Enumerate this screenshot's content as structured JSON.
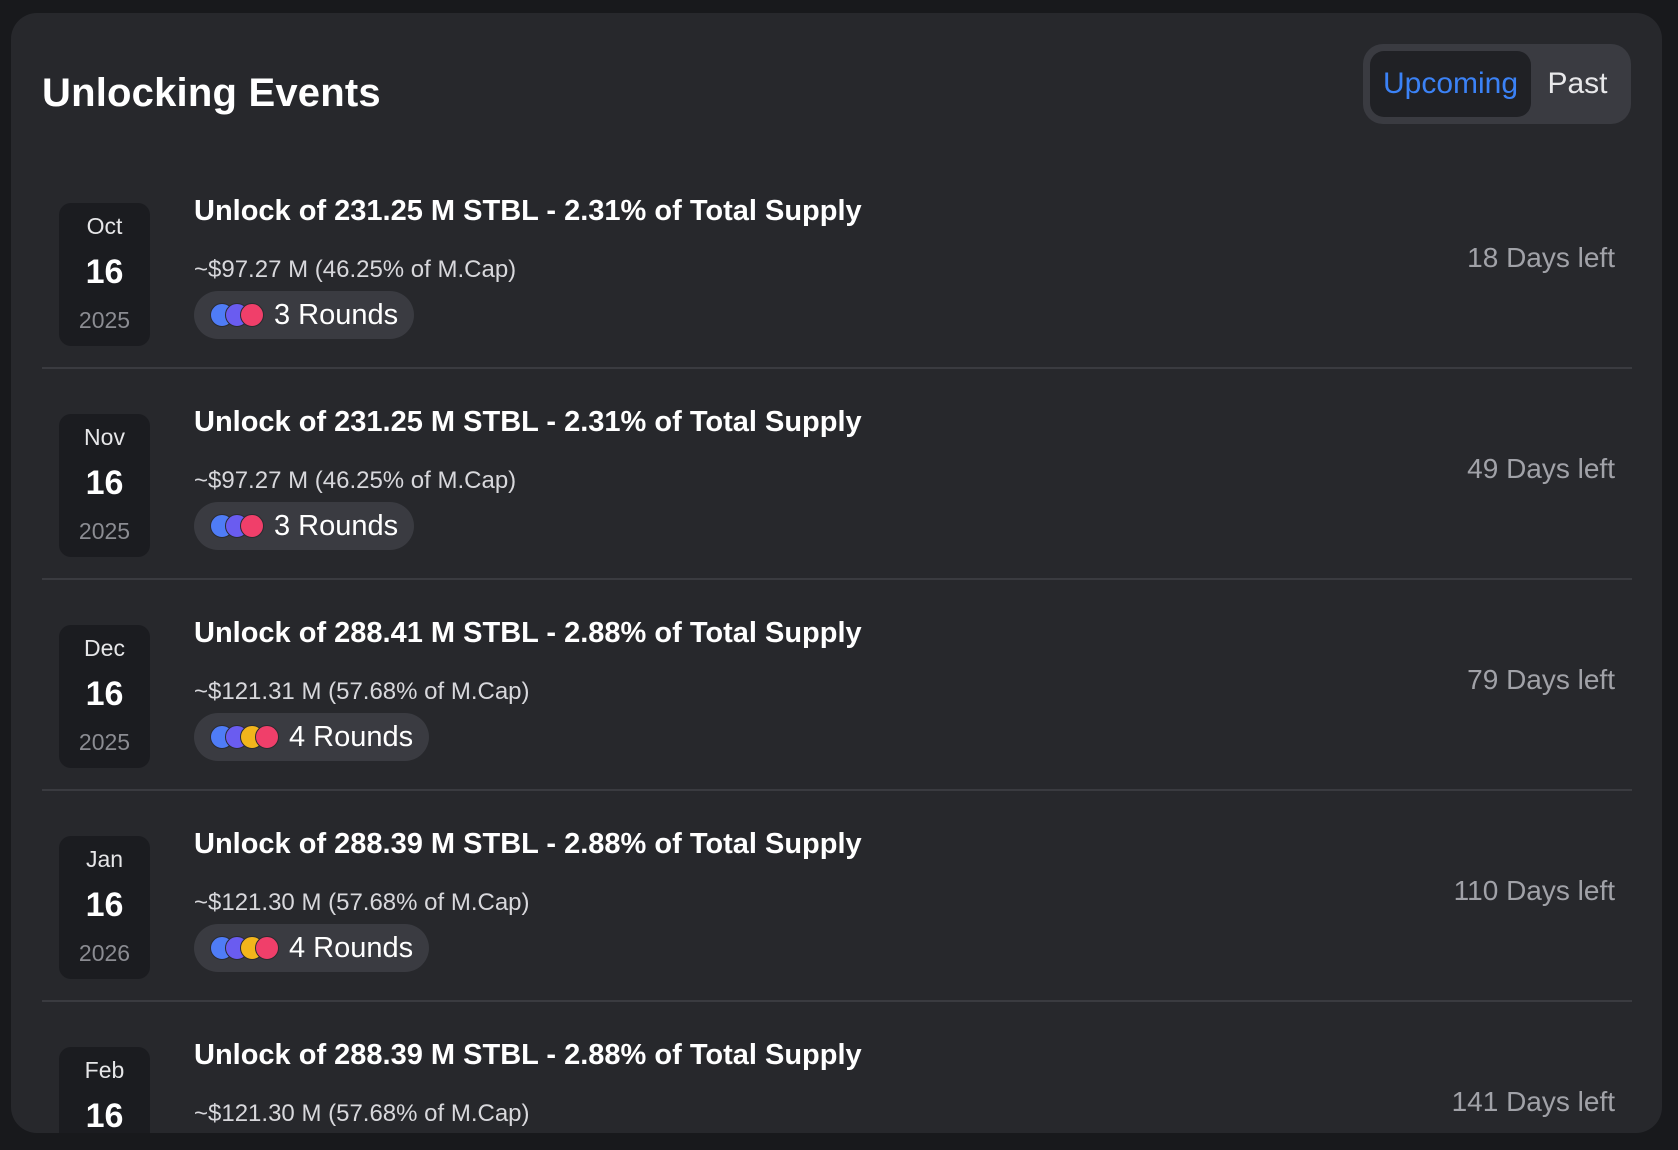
{
  "title": "Unlocking Events",
  "toggle": {
    "active": "Upcoming",
    "inactive": "Past"
  },
  "colors": {
    "accent": "#3b82f6",
    "dot_blue": "#4f7cf6",
    "dot_purple": "#6a5cf0",
    "dot_yellow": "#f2b51c",
    "dot_red": "#f03f6a"
  },
  "events": [
    {
      "month": "Oct",
      "day": "16",
      "year": "2025",
      "headline": "Unlock of 231.25 M STBL - 2.31% of Total Supply",
      "sub": "~$97.27 M (46.25% of M.Cap)",
      "rounds": "3 Rounds",
      "days_left": "18 Days left",
      "dot_colors": [
        "#4f7cf6",
        "#6a5cf0",
        "#f03f6a"
      ]
    },
    {
      "month": "Nov",
      "day": "16",
      "year": "2025",
      "headline": "Unlock of 231.25 M STBL - 2.31% of Total Supply",
      "sub": "~$97.27 M (46.25% of M.Cap)",
      "rounds": "3 Rounds",
      "days_left": "49 Days left",
      "dot_colors": [
        "#4f7cf6",
        "#6a5cf0",
        "#f03f6a"
      ]
    },
    {
      "month": "Dec",
      "day": "16",
      "year": "2025",
      "headline": "Unlock of 288.41 M STBL - 2.88% of Total Supply",
      "sub": "~$121.31 M (57.68% of M.Cap)",
      "rounds": "4 Rounds",
      "days_left": "79 Days left",
      "dot_colors": [
        "#4f7cf6",
        "#6a5cf0",
        "#f2b51c",
        "#f03f6a"
      ]
    },
    {
      "month": "Jan",
      "day": "16",
      "year": "2026",
      "headline": "Unlock of 288.39 M STBL - 2.88% of Total Supply",
      "sub": "~$121.30 M (57.68% of M.Cap)",
      "rounds": "4 Rounds",
      "days_left": "110 Days left",
      "dot_colors": [
        "#4f7cf6",
        "#6a5cf0",
        "#f2b51c",
        "#f03f6a"
      ]
    },
    {
      "month": "Feb",
      "day": "16",
      "year": "",
      "headline": "Unlock of 288.39 M STBL - 2.88% of Total Supply",
      "sub": "~$121.30 M (57.68% of M.Cap)",
      "rounds": "",
      "days_left": "141 Days left",
      "dot_colors": []
    }
  ]
}
